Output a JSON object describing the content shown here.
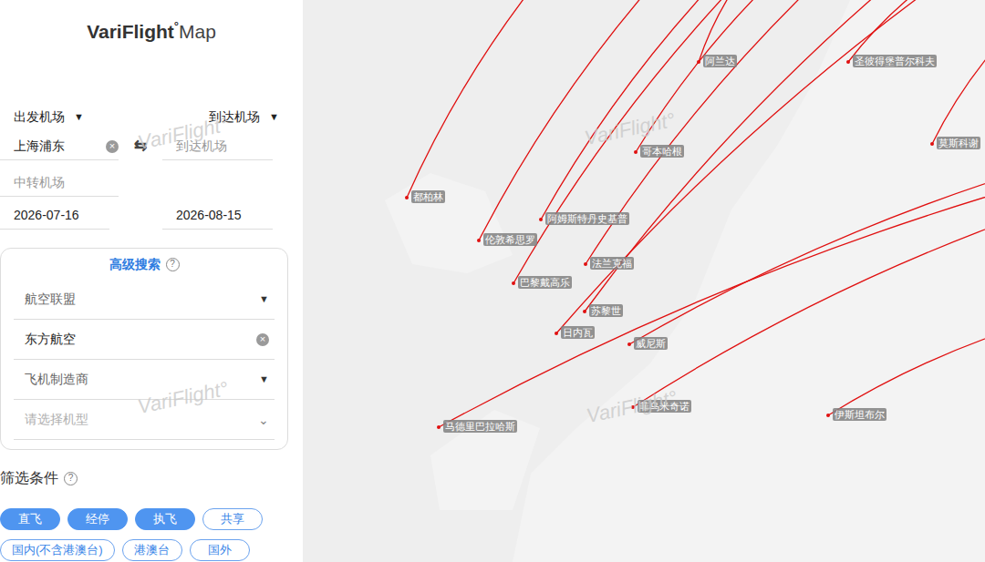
{
  "logo": {
    "brand": "VariFlight",
    "mark": "°",
    "product": "Map"
  },
  "watermarks": [
    "VariFlight°",
    "VariFlight°",
    "VariFlight°",
    "VariFlight°"
  ],
  "search": {
    "departure_label": "出发机场",
    "departure_caret": "▼",
    "arrival_label": "到达机场",
    "arrival_caret": "▼",
    "departure_value": "上海浦东",
    "clear_icon": "×",
    "swap_icon": "⇆",
    "arrival_placeholder": "到达机场",
    "transit_placeholder": "中转机场",
    "date_from": "2026-07-16",
    "date_to": "2026-08-15"
  },
  "advanced": {
    "title": "高级搜索",
    "help": "?",
    "fields": [
      {
        "kind": "select",
        "text": "航空联盟",
        "icon": "▼"
      },
      {
        "kind": "clearable",
        "text": "东方航空",
        "icon": "×"
      },
      {
        "kind": "select",
        "text": "飞机制造商",
        "icon": "▼"
      },
      {
        "kind": "chevron",
        "text": "请选择机型",
        "icon": "⌄"
      }
    ]
  },
  "filters": {
    "title": "筛选条件",
    "help": "?",
    "chips": [
      {
        "label": "直飞",
        "selected": true
      },
      {
        "label": "经停",
        "selected": true
      },
      {
        "label": "执飞",
        "selected": true
      },
      {
        "label": "共享",
        "selected": false
      },
      {
        "label": "国内(不含港澳台)",
        "selected": false
      },
      {
        "label": "港澳台",
        "selected": false
      },
      {
        "label": "国外",
        "selected": false
      }
    ]
  },
  "map": {
    "cities": [
      {
        "label": "都柏林"
      },
      {
        "label": "伦敦希思罗"
      },
      {
        "label": "阿姆斯特丹史基普"
      },
      {
        "label": "哥本哈根"
      },
      {
        "label": "阿兰达"
      },
      {
        "label": "圣彼得堡普尔科夫"
      },
      {
        "label": "莫斯科谢"
      },
      {
        "label": "巴黎戴高乐"
      },
      {
        "label": "法兰克福"
      },
      {
        "label": "苏黎世"
      },
      {
        "label": "日内瓦"
      },
      {
        "label": "威尼斯"
      },
      {
        "label": "菲乌米奇诺"
      },
      {
        "label": "马德里巴拉哈斯"
      },
      {
        "label": "伊斯坦布尔"
      }
    ]
  }
}
